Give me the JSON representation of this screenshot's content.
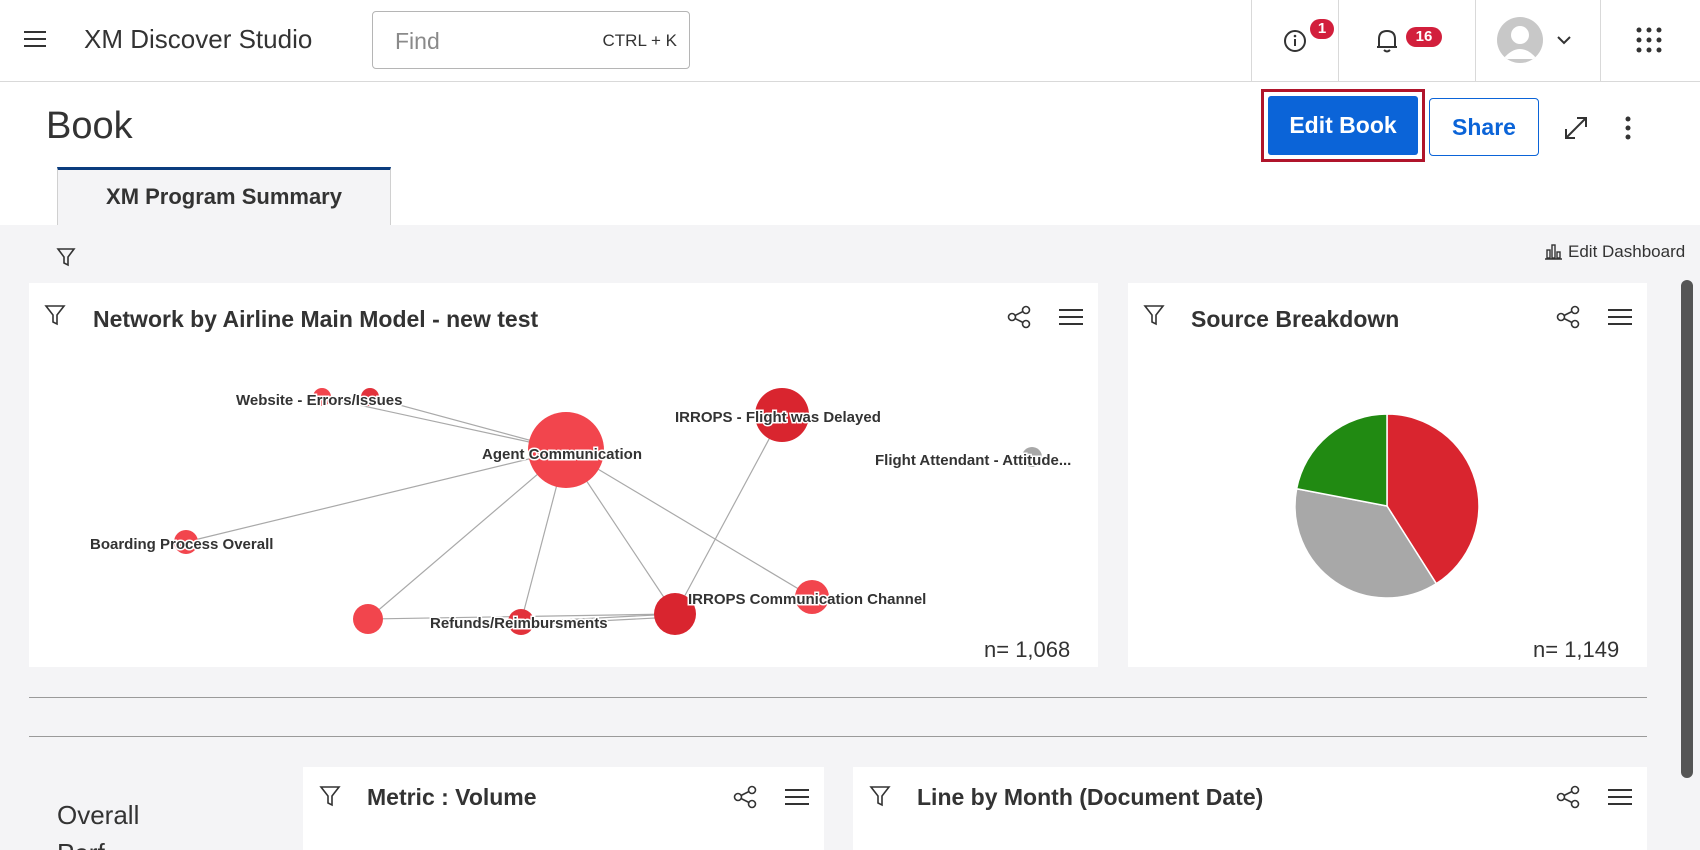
{
  "app": {
    "title": "XM Discover Studio"
  },
  "search": {
    "placeholder": "Find",
    "shortcut": "CTRL + K"
  },
  "notifications": {
    "info_count": "1",
    "bell_count": "16"
  },
  "page": {
    "title": "Book"
  },
  "actions": {
    "edit_book": "Edit Book",
    "share": "Share"
  },
  "tabs": [
    {
      "label": "XM Program Summary",
      "active": true
    }
  ],
  "toolbar": {
    "edit_dashboard": "Edit Dashboard"
  },
  "widgets": {
    "network": {
      "title": "Network by Airline Main Model - new test",
      "n_label": "n= 1,068",
      "nodes": [
        "Website - Errors/Issues",
        "IRROPS - Flight was Delayed",
        "Agent Communication",
        "Flight Attendant - Attitude...",
        "Boarding Process Overall",
        "IRROPS Communication Channel",
        "Refunds/Reimbursments"
      ]
    },
    "source": {
      "title": "Source Breakdown",
      "n_label": "n= 1,149"
    },
    "metric": {
      "title": "Metric : Volume"
    },
    "line": {
      "title": "Line by Month (Document Date)"
    }
  },
  "sections": {
    "overall_label": "Overall",
    "overall_label_2": "Perf"
  },
  "colors": {
    "accent": "#0b64d8",
    "badge": "#d21f3c",
    "highlight_border": "#b0142b",
    "pie_red": "#d9252f",
    "pie_gray": "#a8a8a8",
    "pie_green": "#218a12"
  },
  "chart_data": {
    "type": "pie",
    "title": "Source Breakdown",
    "values": [
      41,
      37,
      22
    ],
    "colors": [
      "#d9252f",
      "#a8a8a8",
      "#218a12"
    ]
  }
}
